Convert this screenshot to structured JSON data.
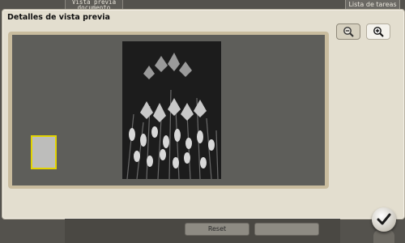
{
  "top_tabs": {
    "preview_document": "Vista previa\ndocumento",
    "job_list": "Lista de tareas"
  },
  "panel": {
    "title": "Detalles de vista previa"
  },
  "bottom": {
    "left_button": "Reset",
    "right_button": ""
  },
  "icons": {
    "zoom_out": "zoom-out-icon",
    "zoom_in": "zoom-in-icon",
    "ok": "checkmark-icon"
  },
  "colors": {
    "panel_bg": "#e3decf",
    "preview_bg": "#5e5e5a",
    "thumbnail_highlight": "#e3d400"
  }
}
